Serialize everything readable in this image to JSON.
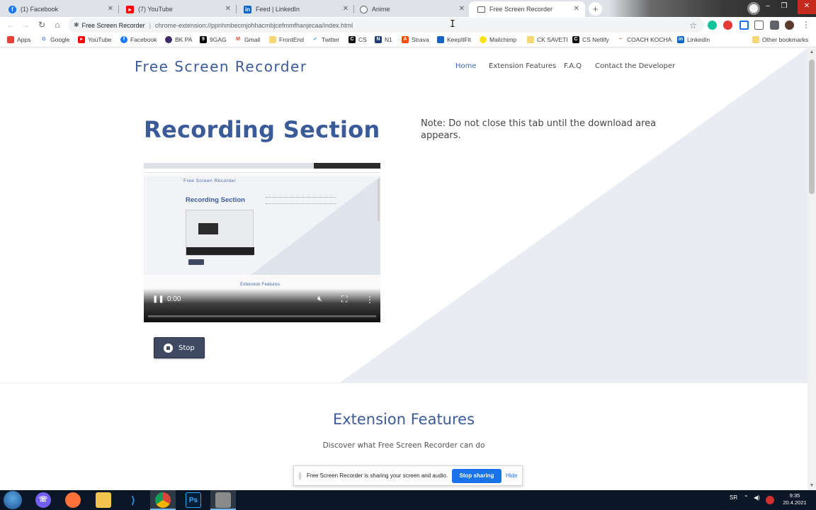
{
  "browser": {
    "tabs": [
      {
        "title": "(1) Facebook",
        "icon": "facebook-icon",
        "color": "#1877f2"
      },
      {
        "title": "(7) YouTube",
        "icon": "youtube-icon",
        "color": "#ff0000"
      },
      {
        "title": "Feed | LinkedIn",
        "icon": "linkedin-icon",
        "color": "#0a66c2"
      },
      {
        "title": "Anime",
        "icon": "globe-icon",
        "color": "#5f6368"
      },
      {
        "title": "Free Screen Recorder",
        "icon": "screen-icon",
        "color": "#5f6368"
      }
    ],
    "site_name": "Free Screen Recorder",
    "url": "chrome-extension://ppnhmbecmjohhacmbjcefmmfhanjecaa/index.html",
    "bookmarks": [
      {
        "label": "Apps",
        "icon": "apps-grid-icon",
        "color": "#e94235"
      },
      {
        "label": "Google",
        "icon": "google-icon",
        "color": "#4285f4"
      },
      {
        "label": "YouTube",
        "icon": "youtube-icon",
        "color": "#ff0000"
      },
      {
        "label": "Facebook",
        "icon": "facebook-icon",
        "color": "#1877f2"
      },
      {
        "label": "BK PA",
        "icon": "bk-icon",
        "color": "#3d2b6b"
      },
      {
        "label": "9GAG",
        "icon": "9gag-icon",
        "color": "#000000"
      },
      {
        "label": "Gmail",
        "icon": "gmail-icon",
        "color": "#ea4335"
      },
      {
        "label": "FrontEnd",
        "icon": "folder-icon",
        "color": "#f7d774"
      },
      {
        "label": "Twitter",
        "icon": "twitter-icon",
        "color": "#1da1f2"
      },
      {
        "label": "CS",
        "icon": "cs-icon",
        "color": "#111111"
      },
      {
        "label": "N1",
        "icon": "n1-icon",
        "color": "#1f3b73"
      },
      {
        "label": "Strava",
        "icon": "strava-icon",
        "color": "#fc4c02"
      },
      {
        "label": "KeepItFit",
        "icon": "keepitfit-icon",
        "color": "#1565c0"
      },
      {
        "label": "Mailchimp",
        "icon": "mailchimp-icon",
        "color": "#ffe01b"
      },
      {
        "label": "CK SAVETI",
        "icon": "folder-icon",
        "color": "#f7d774"
      },
      {
        "label": "CS Netlify",
        "icon": "cs-icon",
        "color": "#111111"
      },
      {
        "label": "COACH KOCHA",
        "icon": "coach-icon",
        "color": "#e53935"
      },
      {
        "label": "LinkedIn",
        "icon": "linkedin-icon",
        "color": "#0a66c2"
      }
    ],
    "other_bookmarks": "Other bookmarks"
  },
  "page": {
    "brand": "Free Screen Recorder",
    "nav": [
      "Home",
      "Extension Features",
      "F.A.Q",
      "Contact the Developer"
    ],
    "recording_title": "Recording Section",
    "note": "Note: Do not close this tab until the download area appears.",
    "video": {
      "time": "0:00",
      "mini_brand": "Free Screen Recorder",
      "mini_title": "Recording Section",
      "mini_section": "Extension Features"
    },
    "stop_label": "Stop",
    "features_title": "Extension Features",
    "features_subtitle": "Discover what Free Screen Recorder can do"
  },
  "share_bar": {
    "message": "Free Screen Recorder is sharing your screen and audio.",
    "stop_label": "Stop sharing",
    "hide_label": "Hide"
  },
  "taskbar": {
    "apps": [
      "Viber",
      "Firefox",
      "File Explorer",
      "VS Code",
      "Chrome",
      "Photoshop",
      "Screen Recorder"
    ],
    "lang": "SR",
    "time": "9:35",
    "date": "20.4.2021"
  },
  "colors": {
    "accent": "#3b5b98",
    "stop_button": "#3f4a62",
    "share_button": "#1a73e8",
    "diagonal": "#e9ecf3"
  }
}
